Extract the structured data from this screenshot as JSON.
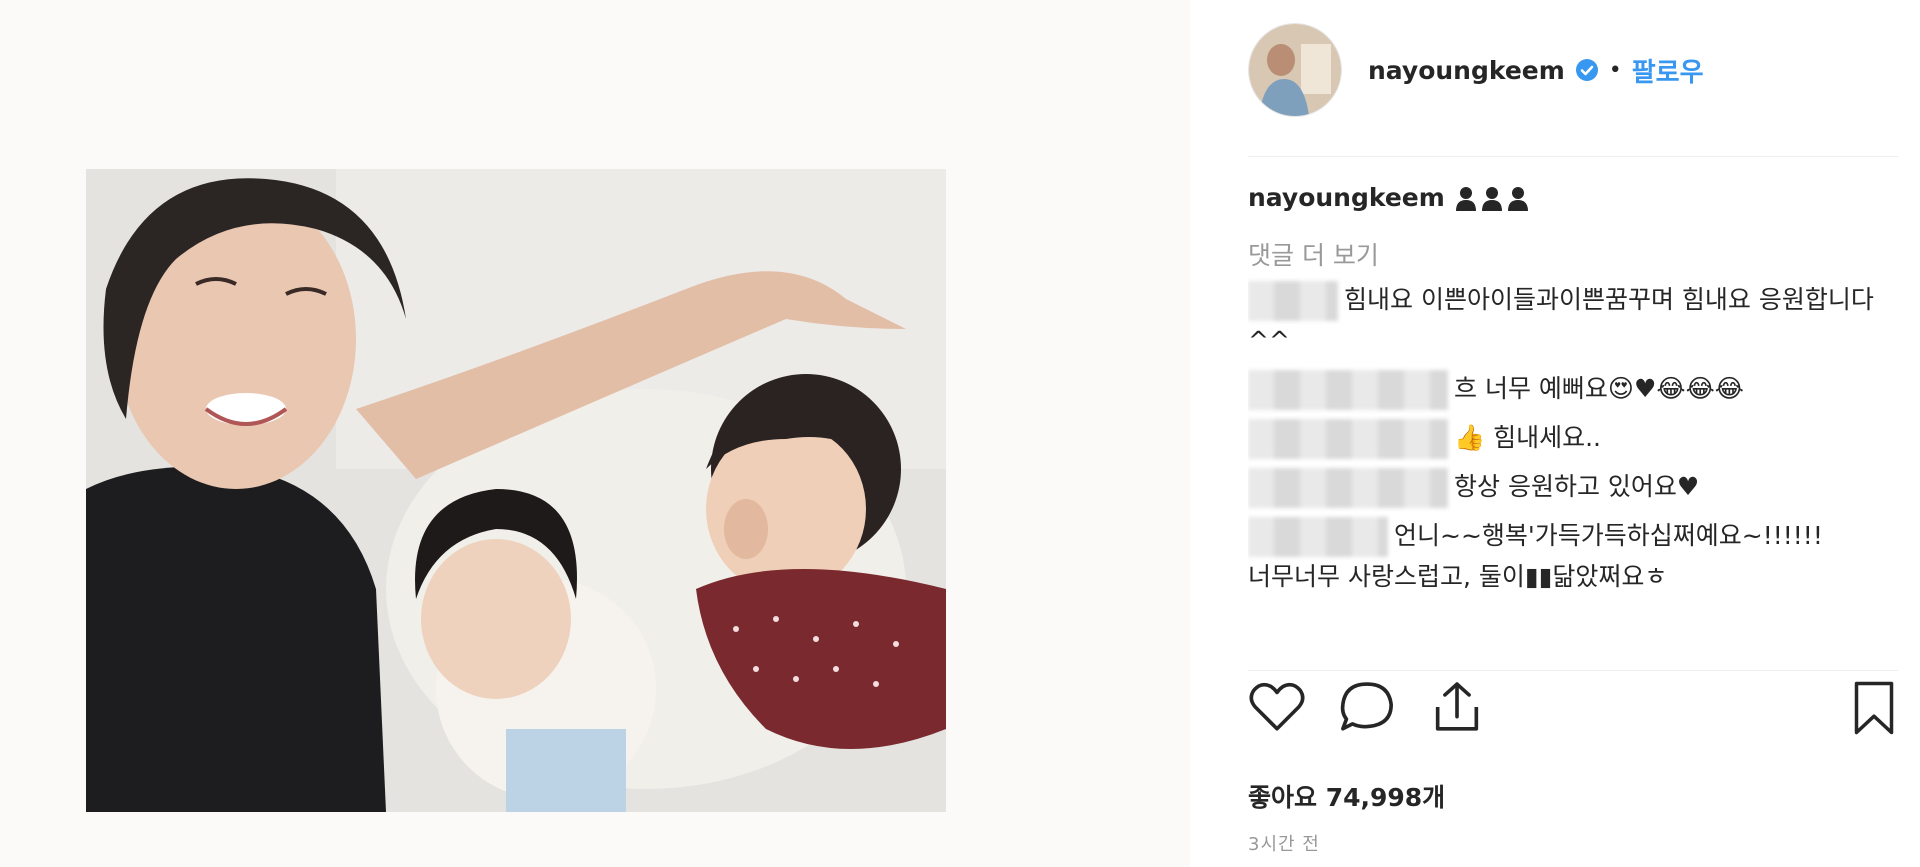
{
  "post": {
    "username": "nayoungkeem",
    "follow_label": "팔로우",
    "separator": "•"
  },
  "caption": {
    "username": "nayoungkeem",
    "emoji_icons": [
      "person-icon",
      "person-icon",
      "person-icon"
    ]
  },
  "comments": {
    "more_label": "댓글 더 보기",
    "items": [
      {
        "text": "힘내요 이쁜아이들과이쁜꿈꾸며 힘내요 응원합니다^^"
      },
      {
        "text": "흐 너무 예뻐요😍♥😂😂😂"
      },
      {
        "text": "👍 힘내세요.."
      },
      {
        "text": "항상 응원하고 있어요♥"
      },
      {
        "text": "언니~~행복'가득가득하십쩌예요~!!!!!! 너무너무 사랑스럽고, 둘이▮▮닮았쩌요ㅎ"
      }
    ]
  },
  "likes": {
    "label": "좋아요 74,998개"
  },
  "time": {
    "label": "3시간 전"
  },
  "colors": {
    "link": "#3897f0",
    "verified": "#3897f0",
    "muted": "#999999",
    "text": "#262626"
  }
}
